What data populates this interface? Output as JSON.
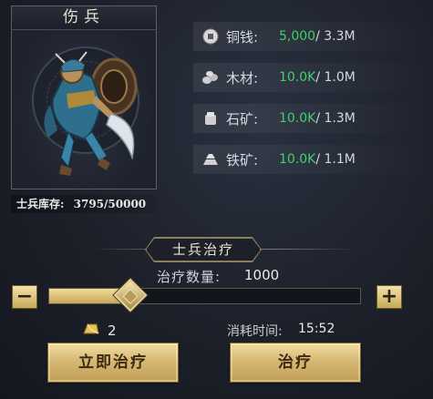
{
  "hero": {
    "title": "伤兵",
    "stock_label": "士兵库存:",
    "stock_value": "3795/50000"
  },
  "resources": [
    {
      "icon": "coin-icon",
      "name": "铜钱:",
      "current": "5,000",
      "max": "/ 3.3M"
    },
    {
      "icon": "wood-icon",
      "name": "木材:",
      "current": "10.0K",
      "max": "/ 1.0M"
    },
    {
      "icon": "stone-icon",
      "name": "石矿:",
      "current": "10.0K",
      "max": "/ 1.3M"
    },
    {
      "icon": "iron-icon",
      "name": "铁矿:",
      "current": "10.0K",
      "max": "/ 1.1M"
    }
  ],
  "heal": {
    "section_title": "士兵治疗",
    "qty_label": "治疗数量:",
    "qty_value": "1000",
    "slider_fraction": 0.26,
    "minus_label": "−",
    "plus_label": "+",
    "gold_cost": "2",
    "time_label": "消耗时间:",
    "time_value": "15:52",
    "instant_button": "立即治疗",
    "heal_button": "治疗"
  },
  "colors": {
    "resource_current": "#3fd16a",
    "button_gold": "#d6b874"
  }
}
